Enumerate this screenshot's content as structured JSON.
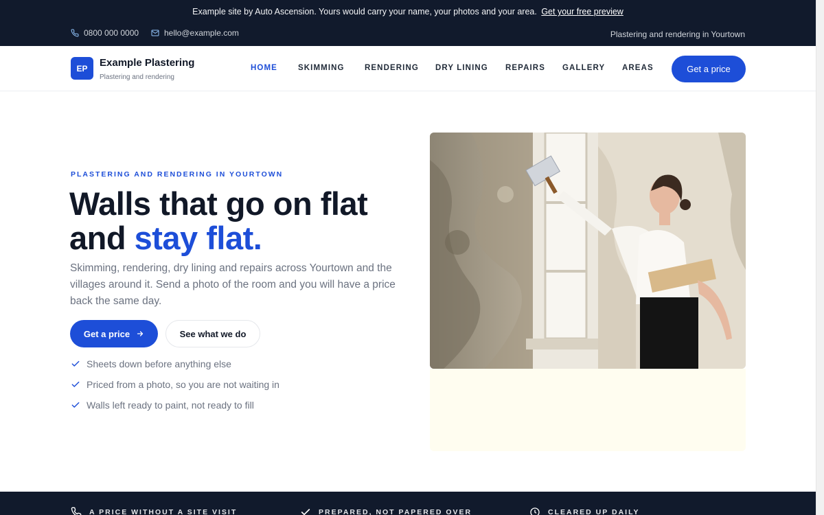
{
  "topbar": {
    "notice": "Example site by Auto Ascension. Yours would carry your name, your photos and your area.",
    "notice_link": "Get your free preview",
    "phone": "0800 000 0000",
    "email": "hello@example.com",
    "tagline": "Plastering and rendering in Yourtown"
  },
  "header": {
    "logo_initials": "EP",
    "brand_name": "Example Plastering",
    "brand_sub": "Plastering and rendering",
    "nav": [
      {
        "label": "HOME",
        "active": true
      },
      {
        "label": "SKIMMING",
        "active": false
      },
      {
        "label": "RENDERING",
        "active": false
      },
      {
        "label": "DRY LINING",
        "active": false
      },
      {
        "label": "REPAIRS",
        "active": false
      },
      {
        "label": "GALLERY",
        "active": false
      },
      {
        "label": "AREAS",
        "active": false
      }
    ],
    "cta": "Get a price"
  },
  "hero": {
    "eyebrow": "PLASTERING AND RENDERING IN YOURTOWN",
    "headline_line1": "Walls that go on flat",
    "headline_line2_plain": "and ",
    "headline_line2_accent": "stay flat.",
    "lede": "Skimming, rendering, dry lining and repairs across Yourtown and the villages around it. Send a photo of the room and you will have a price back the same day.",
    "primary_cta": "Get a price",
    "secondary_cta": "See what we do",
    "checks": [
      "Sheets down before anything else",
      "Priced from a photo, so you are not waiting in",
      "Walls left ready to paint, not ready to fill"
    ]
  },
  "features": [
    {
      "icon": "phone-icon",
      "label": "A PRICE WITHOUT A SITE VISIT"
    },
    {
      "icon": "check-icon",
      "label": "PREPARED, NOT PAPERED OVER"
    },
    {
      "icon": "clock-icon",
      "label": "CLEARED UP DAILY"
    }
  ],
  "colors": {
    "brand": "#1d4ed8",
    "dark": "#111a2c",
    "text_muted": "#6b7280"
  }
}
